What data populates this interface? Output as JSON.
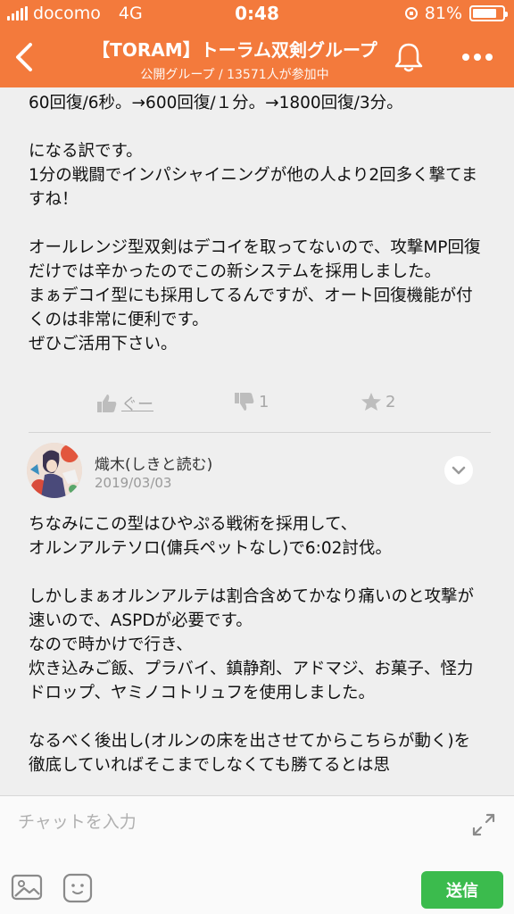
{
  "status_bar": {
    "carrier": "docomo",
    "network": "4G",
    "time": "0:48",
    "battery_text": "81%",
    "battery_level": 0.81
  },
  "header": {
    "title": "【TORAM】トーラム双剣グループ",
    "subtitle": "公開グループ / 13571人が参加中",
    "accent_color": "#f37a3c"
  },
  "messages": [
    {
      "lines_a": "60回復/6秒。→600回復/１分。→1800回復/3分。",
      "lines_b": "になる訳です。\n1分の戦闘でインパシャイニングが他の人より2回多く撃てますね！",
      "lines_c": "オールレンジ型双剣はデコイを取ってないので、攻撃MP回復だけでは辛かったのでこの新システムを採用しました。\nまぁデコイ型にも採用してるんですが、オート回復機能が付くのは非常に便利です。\nぜひご活用下さい。",
      "reactions": {
        "like": "ぐー",
        "dislike": "1",
        "star": "2"
      }
    },
    {
      "author": "熾木(しきと読む)",
      "date": "2019/03/03",
      "para1": "ちなみにこの型はひやぷる戦術を採用して、\nオルンアルテソロ(傭兵ペットなし)で6:02討伐。",
      "para2": "しかしまぁオルンアルテは割合含めてかなり痛いのと攻撃が速いので、ASPDが必要です。\nなので時かけで行き、\n炊き込みご飯、プラバイ、鎮静剤、アドマジ、お菓子、怪力ドロップ、ヤミノコトリュフを使用しました。",
      "para3": "なるべく後出し(オルンの床を出させてからこちらが動く)を徹底していればそこまでしなくても勝てるとは思"
    }
  ],
  "input_bar": {
    "placeholder": "チャットを入力",
    "send_label": "送信",
    "send_color": "#3bbb4d"
  },
  "icons": [
    "back-icon",
    "bell-icon",
    "more-icon",
    "thumb-up-icon",
    "thumb-down-icon",
    "star-icon",
    "chevron-down-icon",
    "expand-icon",
    "image-icon",
    "emoji-icon"
  ]
}
